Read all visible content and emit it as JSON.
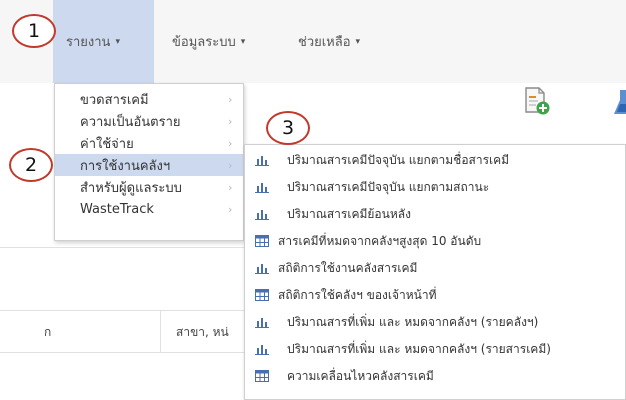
{
  "nav": {
    "items": [
      {
        "label": "รายงาน",
        "active": true
      },
      {
        "label": "ข้อมูลระบบ",
        "active": false
      },
      {
        "label": "ช่วยเหลือ",
        "active": false
      }
    ],
    "caret": "▾"
  },
  "markers": [
    "1",
    "2",
    "3"
  ],
  "dropdown": {
    "arrow": "›",
    "items": [
      {
        "label": "ขวดสารเคมี"
      },
      {
        "label": "ความเป็นอันตราย"
      },
      {
        "label": "ค่าใช้จ่าย"
      },
      {
        "label": "การใช้งานคลังฯ",
        "active": true
      },
      {
        "label": "สำหรับผู้ดูแลระบบ"
      },
      {
        "label": "WasteTrack"
      }
    ]
  },
  "submenu": {
    "items": [
      {
        "icon": "bar-chart-icon",
        "label": "ปริมาณสารเคมีปัจจุบัน แยกตามชื่อสารเคมี"
      },
      {
        "icon": "bar-chart-icon",
        "label": "ปริมาณสารเคมีปัจจุบัน แยกตามสถานะ"
      },
      {
        "icon": "bar-chart-icon",
        "label": "ปริมาณสารเคมีย้อนหลัง"
      },
      {
        "icon": "table-icon",
        "label": "สารเคมีที่หมดจากคลังฯสูงสุด 10 อันดับ"
      },
      {
        "icon": "bar-chart-icon",
        "label": "สถิติการใช้งานคลังสารเคมี"
      },
      {
        "icon": "table-icon",
        "label": "สถิติการใช้คลังฯ ของเจ้าหน้าที่"
      },
      {
        "icon": "bar-chart-icon",
        "label": "ปริมาณสารที่เพิ่ม และ หมดจากคลังฯ (รายคลังฯ)"
      },
      {
        "icon": "bar-chart-icon",
        "label": "ปริมาณสารที่เพิ่ม และ หมดจากคลังฯ (รายสารเคมี)"
      },
      {
        "icon": "table-icon",
        "label": "ความเคลื่อนไหวคลังสารเคมี"
      }
    ]
  },
  "content": {
    "col_left_fragment": "ก",
    "col_branch": "สาขา, หน่"
  },
  "colors": {
    "active_bg": "#cdd9ef",
    "marker_border": "#c0392b",
    "icon_blue": "#4a6fb0"
  }
}
